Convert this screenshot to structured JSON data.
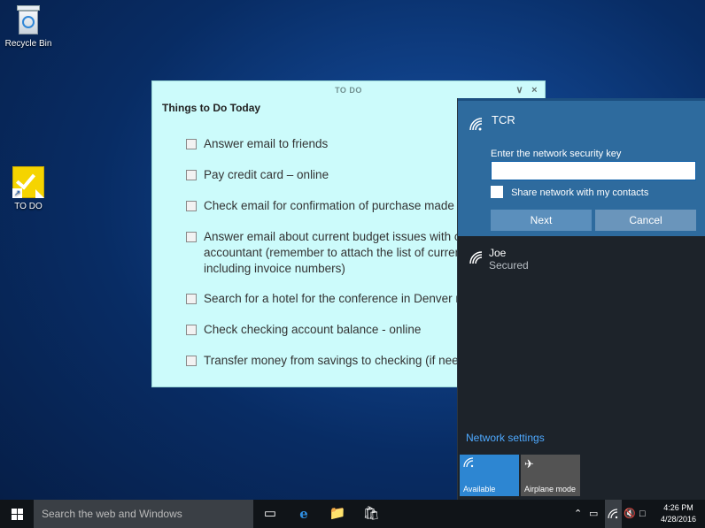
{
  "desktop": {
    "recycle_bin_label": "Recycle Bin",
    "todo_label": "TO DO"
  },
  "note": {
    "title": "TO DO",
    "heading": "Things to Do Today",
    "tasks": [
      "Answer email to friends",
      "Pay credit card – online",
      "Check email for confirmation of purchase made e",
      "Answer email about current budget issues with co\naccountant (remember to attach the list of current\nincluding invoice numbers)",
      "Search for a hotel for the conference in Denver ne",
      "Check checking account balance - online",
      "Transfer money from savings to checking (if need"
    ]
  },
  "wifi": {
    "connecting_network": "TCR",
    "key_label": "Enter the network security key",
    "key_value": "",
    "share_label": "Share network with my contacts",
    "next_label": "Next",
    "cancel_label": "Cancel",
    "other_network": "Joe",
    "other_status": "Secured",
    "settings_link": "Network settings",
    "tile_available": "Available",
    "tile_airplane": "Airplane mode"
  },
  "taskbar": {
    "search_placeholder": "Search the web and Windows",
    "time": "4:26 PM",
    "date": "4/28/2016"
  },
  "colors": {
    "note_bg": "#ccfbfb",
    "flyout_bg": "#1d232a",
    "tcr_panel": "#2e6b9e",
    "link": "#4ea9ff",
    "tile_active": "#2d86d2"
  }
}
